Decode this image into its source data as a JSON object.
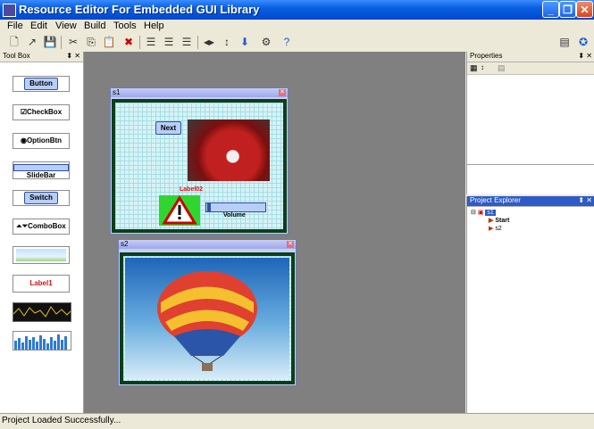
{
  "app": {
    "title": "Resource Editor For Embedded GUI Library"
  },
  "menu": [
    "File",
    "Edit",
    "View",
    "Build",
    "Tools",
    "Help"
  ],
  "toolbox": {
    "title": "Tool Box",
    "pin": "⬍ ✕",
    "items": {
      "button": "Button",
      "checkbox": "CheckBox",
      "optionbtn": "OptionBtn",
      "slidebar": "SlideBar",
      "switch": "Switch",
      "combobox": "ComboBox",
      "label": "Label1"
    }
  },
  "canvas": {
    "s1": {
      "title": "s1",
      "next": "Next",
      "label": "Label02",
      "volume": "Volume"
    },
    "s2": {
      "title": "s2"
    }
  },
  "properties": {
    "title": "Properties",
    "pin": "⬍ ✕"
  },
  "explorer": {
    "title": "Project Explorer",
    "pin": "⬍ ✕",
    "root": "s1",
    "children": [
      "Start",
      "s2"
    ]
  },
  "status": {
    "text": "Project Loaded Successfully..."
  },
  "colors": {
    "titlebar": "#0a5fe0",
    "canvas": "#808080",
    "grid": "#d6f3f6",
    "frame": "#0d3e1c",
    "label": "#e01010"
  }
}
